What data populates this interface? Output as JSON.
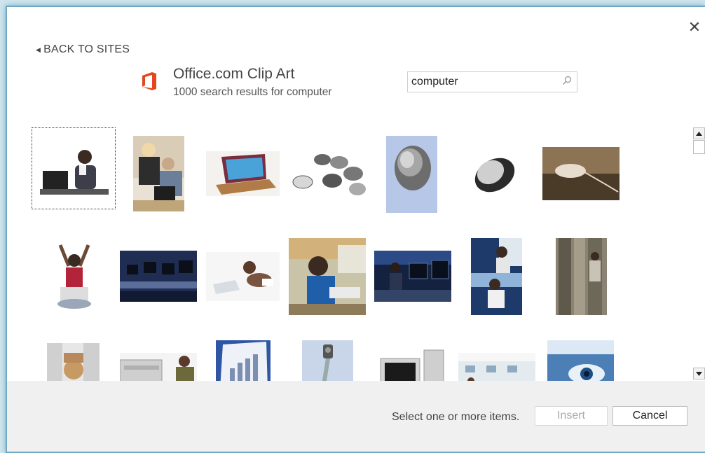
{
  "dialog": {
    "close_glyph": "✕",
    "back_label": "BACK TO SITES",
    "brand_title": "Office.com Clip Art",
    "result_count": "1000 search results for computer",
    "colors": {
      "office_orange": "#e3471e",
      "frame": "#6fa9c3",
      "footer_bg": "#f0f0f0"
    }
  },
  "search": {
    "value": "computer",
    "icon": "search-icon"
  },
  "grid": {
    "items": [
      {
        "name": "woman-at-laptop-clip",
        "selected": true
      },
      {
        "name": "two-people-at-computer-clip"
      },
      {
        "name": "red-laptop-clip"
      },
      {
        "name": "row-of-mice-clip"
      },
      {
        "name": "mouse-closeup-clip"
      },
      {
        "name": "silver-mouse-clip"
      },
      {
        "name": "sepia-mouse-clip"
      },
      {
        "name": "cheering-girl-laptop-clip"
      },
      {
        "name": "computer-lab-clip"
      },
      {
        "name": "baby-crawling-laptop-clip"
      },
      {
        "name": "girl-smiling-at-computer-clip"
      },
      {
        "name": "woman-in-dark-office-clip"
      },
      {
        "name": "two-women-at-desk-clip"
      },
      {
        "name": "server-room-person-clip"
      },
      {
        "name": "woman-with-servers-clip"
      },
      {
        "name": "man-at-server-rack-clip"
      },
      {
        "name": "bar-chart-screen-clip"
      },
      {
        "name": "webcam-clip"
      },
      {
        "name": "monitor-and-tower-clip"
      },
      {
        "name": "library-computers-clip"
      },
      {
        "name": "eye-on-screen-clip"
      }
    ]
  },
  "footer": {
    "hint": "Select one or more items.",
    "insert_label": "Insert",
    "cancel_label": "Cancel"
  }
}
